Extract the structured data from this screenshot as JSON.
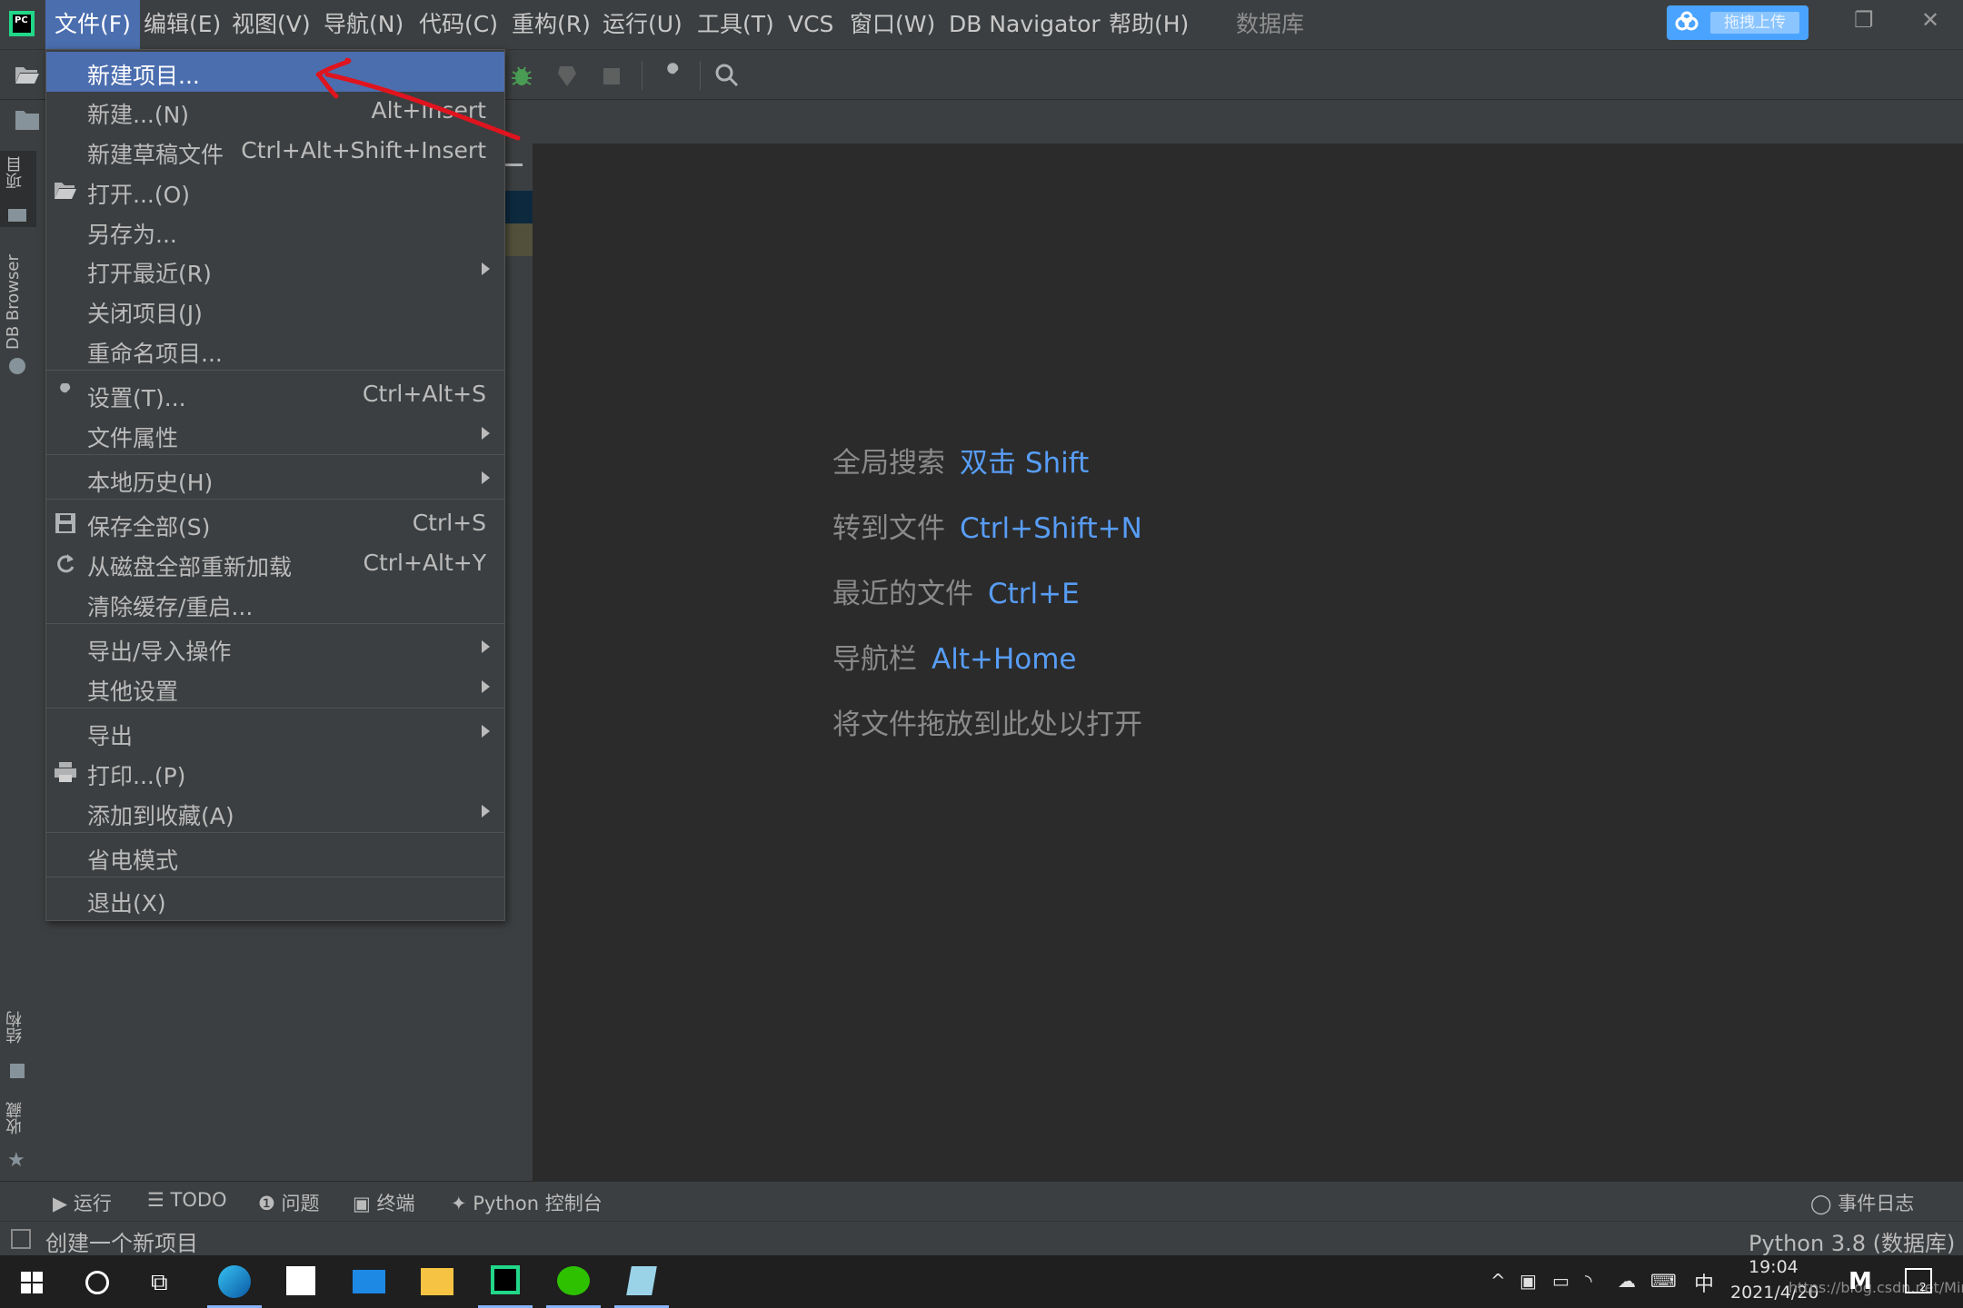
{
  "menubar": {
    "items": [
      "文件(F)",
      "编辑(E)",
      "视图(V)",
      "导航(N)",
      "代码(C)",
      "重构(R)",
      "运行(U)",
      "工具(T)",
      "VCS",
      "窗口(W)",
      "DB Navigator",
      "帮助(H)"
    ],
    "project_title": "数据库",
    "upload_button": "拖拽上传",
    "app_logo": "PC"
  },
  "file_menu": {
    "items": [
      {
        "label": "新建项目...",
        "shortcut": "",
        "submenu": false,
        "selected": true
      },
      {
        "label": "新建...(N)",
        "shortcut": "Alt+Insert",
        "submenu": false
      },
      {
        "label": "新建草稿文件",
        "shortcut": "Ctrl+Alt+Shift+Insert",
        "submenu": false
      },
      {
        "label": "打开...(O)",
        "shortcut": "",
        "submenu": false,
        "icon": "folder-open-icon"
      },
      {
        "label": "另存为...",
        "shortcut": "",
        "submenu": false
      },
      {
        "label": "打开最近(R)",
        "shortcut": "",
        "submenu": true
      },
      {
        "label": "关闭项目(J)",
        "shortcut": "",
        "submenu": false
      },
      {
        "label": "重命名项目...",
        "shortcut": "",
        "submenu": false
      },
      {
        "label": "设置(T)...",
        "shortcut": "Ctrl+Alt+S",
        "submenu": false,
        "icon": "wrench-icon"
      },
      {
        "label": "文件属性",
        "shortcut": "",
        "submenu": true
      },
      {
        "label": "本地历史(H)",
        "shortcut": "",
        "submenu": true
      },
      {
        "label": "保存全部(S)",
        "shortcut": "Ctrl+S",
        "submenu": false,
        "icon": "save-icon"
      },
      {
        "label": "从磁盘全部重新加载",
        "shortcut": "Ctrl+Alt+Y",
        "submenu": false,
        "icon": "reload-icon"
      },
      {
        "label": "清除缓存/重启...",
        "shortcut": "",
        "submenu": false
      },
      {
        "label": "导出/导入操作",
        "shortcut": "",
        "submenu": true
      },
      {
        "label": "其他设置",
        "shortcut": "",
        "submenu": true
      },
      {
        "label": "导出",
        "shortcut": "",
        "submenu": true
      },
      {
        "label": "打印...(P)",
        "shortcut": "",
        "submenu": false,
        "icon": "printer-icon"
      },
      {
        "label": "添加到收藏(A)",
        "shortcut": "",
        "submenu": true
      },
      {
        "label": "省电模式",
        "shortcut": "",
        "submenu": false
      },
      {
        "label": "退出(X)",
        "shortcut": "",
        "submenu": false
      }
    ]
  },
  "left_stripe": {
    "project_tab": "项目",
    "db_browser_tab": "DB Browser",
    "structure_tab": "结构",
    "favorites_tab": "收藏"
  },
  "editor_hints": [
    {
      "label": "全局搜索",
      "shortcut": "双击 Shift"
    },
    {
      "label": "转到文件",
      "shortcut": "Ctrl+Shift+N"
    },
    {
      "label": "最近的文件",
      "shortcut": "Ctrl+E"
    },
    {
      "label": "导航栏",
      "shortcut": "Alt+Home"
    },
    {
      "label": "将文件拖放到此处以打开",
      "shortcut": ""
    }
  ],
  "bottom_bar": {
    "run": "运行",
    "todo": "TODO",
    "problems": "问题",
    "terminal": "终端",
    "python_console": "Python 控制台",
    "event_log": "事件日志"
  },
  "status_bar": {
    "message": "创建一个新项目",
    "interpreter": "Python 3.8 (数据库)"
  },
  "taskbar": {
    "time": "19:04",
    "date": "2021/4/20",
    "ime": "中",
    "notification_count": "2",
    "watermark": "https://blog.csdn.net/MiniCNS"
  },
  "colors": {
    "accent": "#4b6eaf",
    "link": "#589df6",
    "menu_bg": "#3c3f41",
    "editor_bg": "#2b2b2b",
    "annotation_arrow": "#e0141e"
  }
}
